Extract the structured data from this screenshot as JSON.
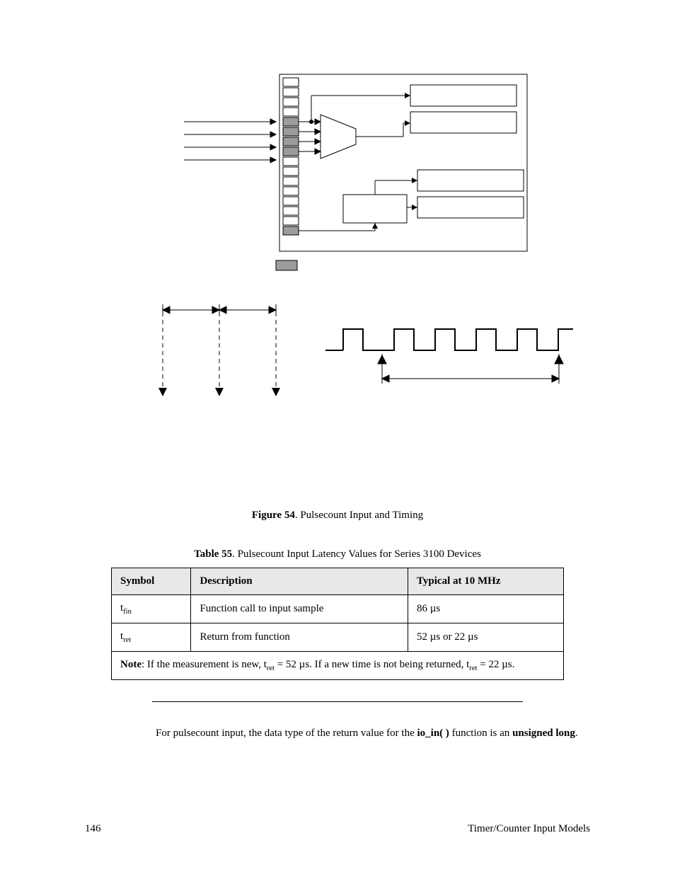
{
  "figure": {
    "label": "Figure 54",
    "caption": ". Pulsecount Input and Timing"
  },
  "table": {
    "label": "Table 55",
    "caption": ". Pulsecount Input Latency Values for Series 3100 Devices",
    "headers": [
      "Symbol",
      "Description",
      "Typical at 10 MHz"
    ],
    "rows": [
      {
        "symbol_base": "t",
        "symbol_sub": "fin",
        "description": "Function call to input sample",
        "typical": "86 µs"
      },
      {
        "symbol_base": "t",
        "symbol_sub": "ret",
        "description": "Return from function",
        "typical": "52 µs or 22 µs"
      }
    ],
    "note_prefix": "Note",
    "note_body_1": ":  If the measurement is new, t",
    "note_sub_1": "ret",
    "note_body_2": " = 52 µs.  If a new time is not being returned, t",
    "note_sub_2": "ret",
    "note_body_3": " = 22 µs."
  },
  "body": {
    "p1_a": "For pulsecount input, the data type of the return value for the ",
    "p1_func": "io_in( )",
    "p1_b": " function is an ",
    "p1_type": "unsigned long",
    "p1_c": "."
  },
  "footer": {
    "page": "146",
    "section": "Timer/Counter Input Models"
  }
}
